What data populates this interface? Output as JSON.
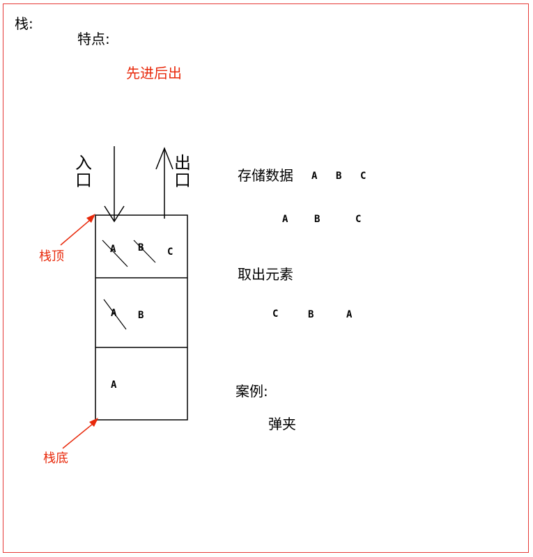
{
  "title": "栈:",
  "feature_label": "特点:",
  "feature_value": "先进后出",
  "in_label": "入口",
  "out_label": "出口",
  "top_label": "栈顶",
  "bottom_label": "栈底",
  "store_label": "存储数据",
  "store_seq": [
    "A",
    "B",
    "C"
  ],
  "store_seq2": [
    "A",
    "B",
    "C"
  ],
  "retrieve_label": "取出元素",
  "retrieve_seq": [
    "C",
    "B",
    "A"
  ],
  "example_label": "案例:",
  "example_value": "弹夹",
  "stack_rows": [
    [
      "A",
      "B",
      "C"
    ],
    [
      "A",
      "B"
    ],
    [
      "A"
    ]
  ],
  "accent_color": "#e8290b"
}
